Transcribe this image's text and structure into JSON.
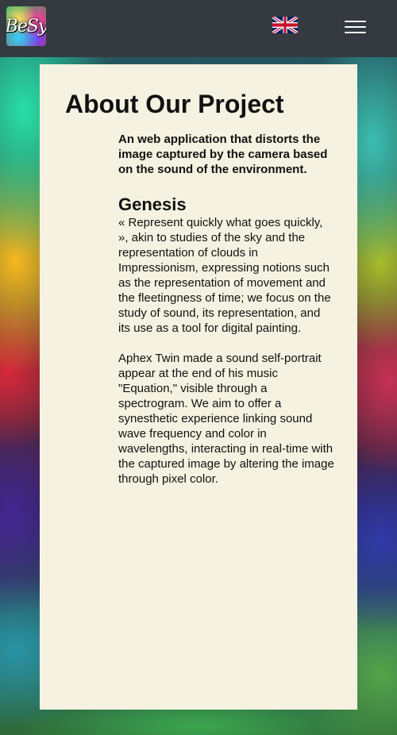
{
  "header": {
    "logo_text": "BeSy",
    "language_flag": "uk-flag-icon",
    "menu_icon": "hamburger-icon"
  },
  "main": {
    "title": "About Our Project",
    "tagline": "An web application that distorts the image captured by the camera based on the sound of the environment.",
    "section_heading": "Genesis",
    "paragraphs": [
      "« Represent quickly what goes quickly, », akin to studies of the sky and the representation of clouds in Impressionism, expressing notions such as the representation of movement and the fleetingness of time; we focus on the study of sound, its representation, and its use as a tool for digital painting.",
      "Aphex Twin made a sound self-portrait appear at the end of his music \"Equation,\" visible through a spectrogram. We aim to offer a synesthetic experience linking sound wave frequency and color in wavelengths, interacting in real-time with the captured image by altering the image through pixel color."
    ]
  },
  "colors": {
    "navbar": "#343a40",
    "card": "#f5f2e1",
    "text": "#111111"
  }
}
